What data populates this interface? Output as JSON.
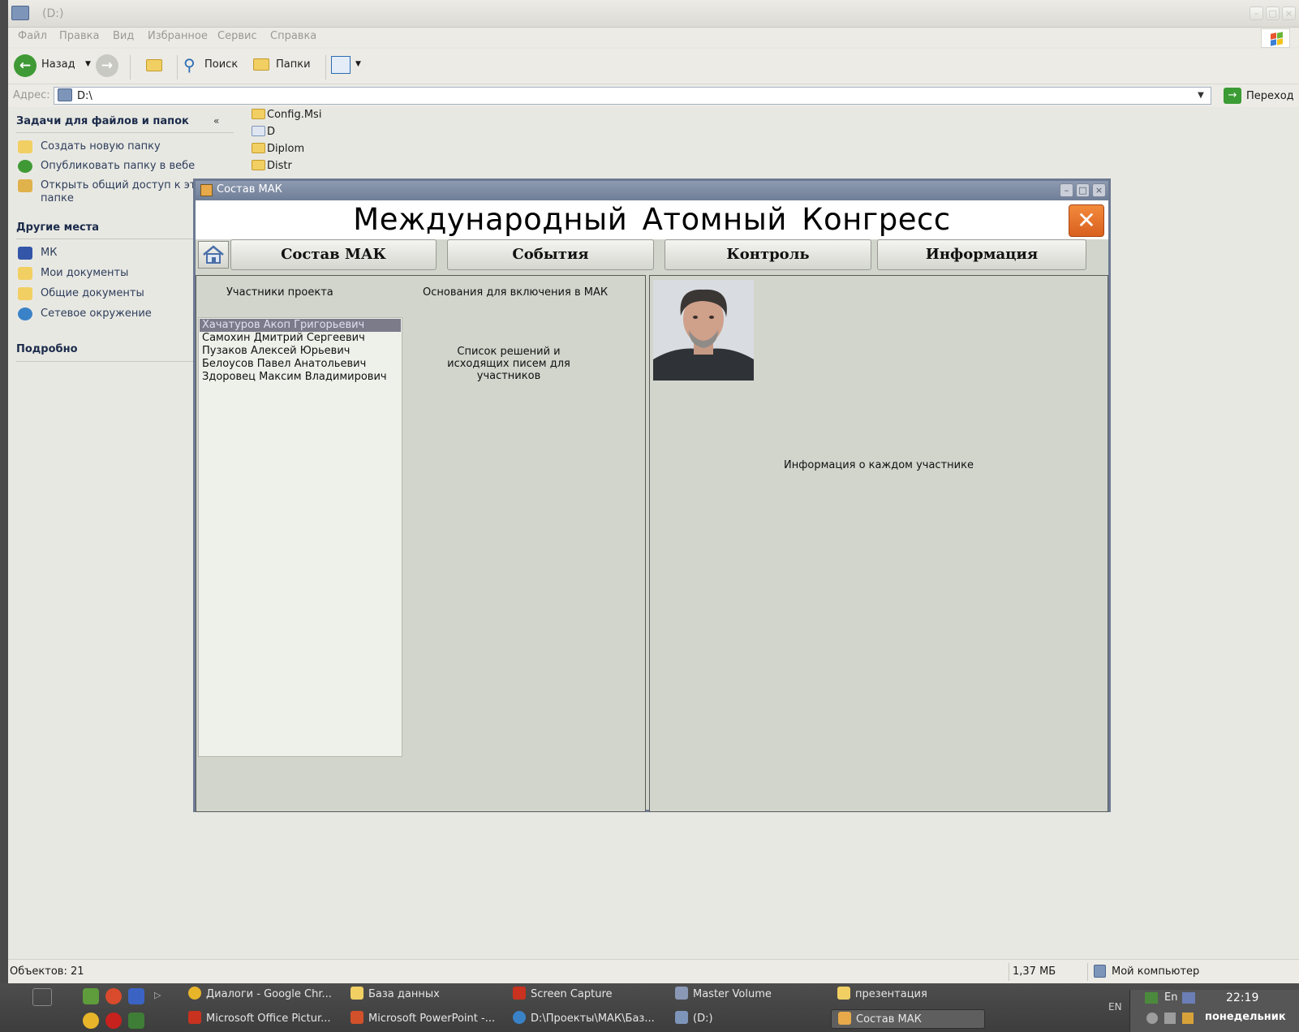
{
  "explorer": {
    "title": "(D:)",
    "menu": [
      "Файл",
      "Правка",
      "Вид",
      "Избранное",
      "Сервис",
      "Справка"
    ],
    "toolbar": {
      "back": "Назад",
      "search": "Поиск",
      "folders": "Папки"
    },
    "address": {
      "label": "Адрес:",
      "value": "D:\\",
      "go": "Переход"
    },
    "sidebar": {
      "tasks_title": "Задачи для файлов и папок",
      "tasks": [
        "Создать новую папку",
        "Опубликовать папку в вебе",
        "Открыть общий доступ к этой папке"
      ],
      "places_title": "Другие места",
      "places": [
        "МК",
        "Мои документы",
        "Общие документы",
        "Сетевое окружение"
      ],
      "details_title": "Подробно"
    },
    "files": [
      "Config.Msi",
      "D",
      "Diplom",
      "Distr"
    ],
    "status": {
      "objects": "Объектов: 21",
      "size": "1,37 МБ",
      "location": "Мой компьютер"
    }
  },
  "app": {
    "title": "Состав МАК",
    "heading": "Международный Атомный Конгресс",
    "nav": [
      "Состав МАК",
      "События",
      "Контроль",
      "Информация"
    ],
    "participants_label": "Участники проекта",
    "grounds_label": "Основания для включения в МАК",
    "decisions_label": "Список решений и исходящих писем для участников",
    "participants": [
      "Хачатуров Акоп Григорьевич",
      "Самохин Дмитрий Сергеевич",
      "Пузаков Алексей Юрьевич",
      "Белоусов Павел Анатольевич",
      "Здоровец Максим Владимирович"
    ],
    "selected_participant": 0,
    "info_label": "Информация о каждом участнике"
  },
  "taskbar": {
    "row1": [
      "Диалоги - Google Chr...",
      "База данных",
      "Screen Capture",
      "Master Volume",
      "презентация"
    ],
    "row2": [
      "Microsoft Office Pictur...",
      "Microsoft PowerPoint -...",
      "D:\\Проекты\\МАК\\Баз...",
      "(D:)",
      "Состав МАК"
    ],
    "lang_left": "EN",
    "lang_tray": "En",
    "time": "22:19",
    "day": "понедельник"
  },
  "colors": {
    "app_bg": "#d1d5cc",
    "close_orange": "#e8712b",
    "selection": "#7b7b8a"
  }
}
